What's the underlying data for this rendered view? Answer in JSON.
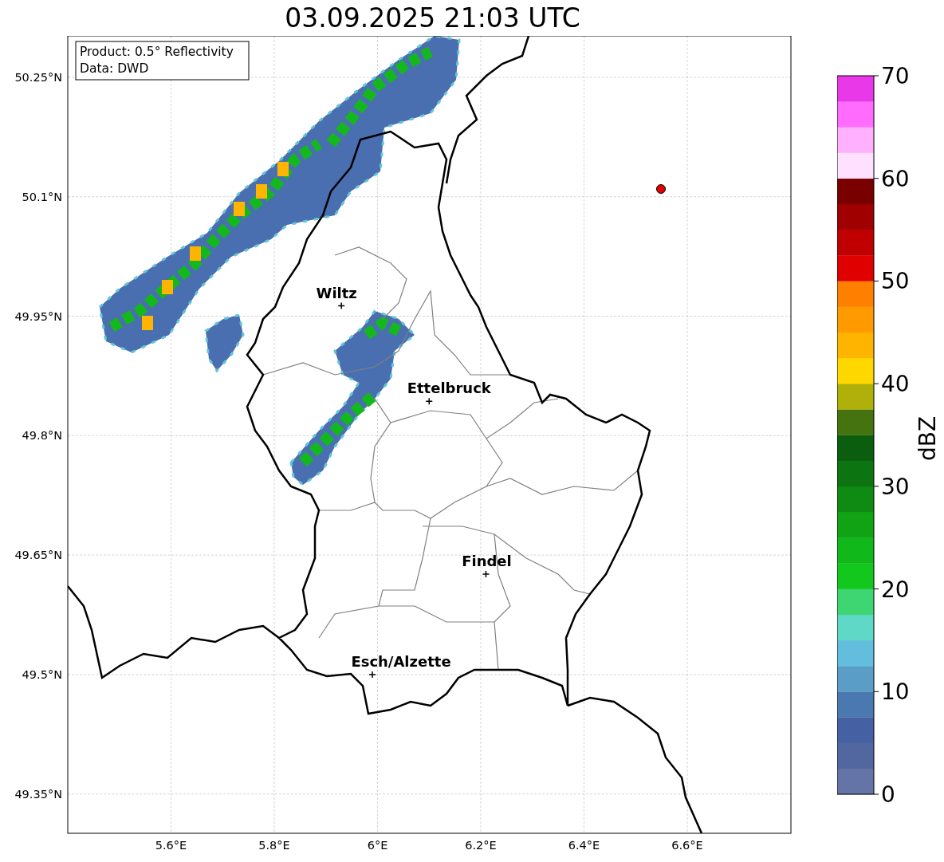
{
  "title": "03.09.2025 21:03 UTC",
  "info_box": {
    "lines": [
      "Product: 0.5° Reflectivity",
      "Data: DWD"
    ]
  },
  "map": {
    "lat_labels": [
      "50.25°N",
      "50.1°N",
      "49.95°N",
      "49.8°N",
      "49.65°N",
      "49.5°N",
      "49.35°N"
    ],
    "lon_labels": [
      "5.6°E",
      "5.8°E",
      "6°E",
      "6.2°E",
      "6.4°E",
      "6.6°E"
    ],
    "cities": [
      {
        "name": "Wiltz"
      },
      {
        "name": "Ettelbruck"
      },
      {
        "name": "Findel"
      },
      {
        "name": "Esch/Alzette"
      }
    ]
  },
  "colorbar": {
    "label": "dBZ",
    "ticks": [
      "70",
      "60",
      "50",
      "40",
      "30",
      "20",
      "10",
      "0"
    ],
    "bins": [
      {
        "color": "#6474a6"
      },
      {
        "color": "#52679f"
      },
      {
        "color": "#4560a3"
      },
      {
        "color": "#4a78b0"
      },
      {
        "color": "#5a9ec8"
      },
      {
        "color": "#62bedc"
      },
      {
        "color": "#5fd8c7"
      },
      {
        "color": "#3dd672"
      },
      {
        "color": "#13c81c"
      },
      {
        "color": "#10b81a"
      },
      {
        "color": "#10a414"
      },
      {
        "color": "#0f8a12"
      },
      {
        "color": "#0c7512"
      },
      {
        "color": "#0a5e0e"
      },
      {
        "color": "#45730f"
      },
      {
        "color": "#b0b00a"
      },
      {
        "color": "#ffd800"
      },
      {
        "color": "#ffb400"
      },
      {
        "color": "#ff9a00"
      },
      {
        "color": "#ff7f00"
      },
      {
        "color": "#e10000"
      },
      {
        "color": "#c00000"
      },
      {
        "color": "#a00000"
      },
      {
        "color": "#7a0000"
      },
      {
        "color": "#ffe0ff"
      },
      {
        "color": "#ffb0ff"
      },
      {
        "color": "#ff6cff"
      },
      {
        "color": "#e838e8"
      }
    ]
  }
}
